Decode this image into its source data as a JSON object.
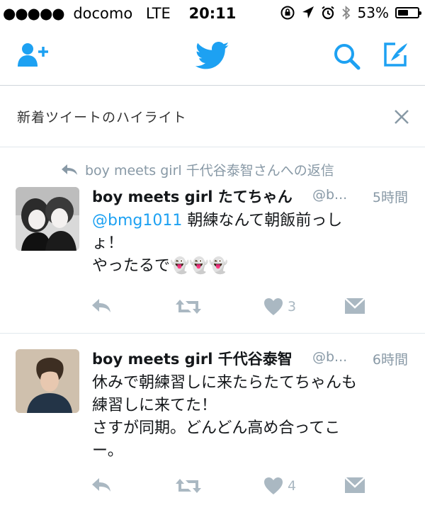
{
  "status_bar": {
    "signal": "●●●●●",
    "carrier": "docomo",
    "network": "LTE",
    "time": "20:11",
    "battery_percent": "53%",
    "battery_level": 0.53
  },
  "nav": {
    "icons": [
      "add-user-icon",
      "twitter-bird-icon",
      "search-icon",
      "compose-icon"
    ],
    "brand_color": "#1da1f2"
  },
  "banner": {
    "title": "新着ツイートのハイライト"
  },
  "tweets": [
    {
      "reply_context": "boy meets girl 千代谷泰智さんへの返信",
      "name": "boy meets girl たてちゃん",
      "handle": "@b...",
      "time": "5時間",
      "mention": "@bmg1011",
      "text_line1": " 朝練なんて朝飯前っし",
      "text_line2": "ょ！",
      "text_line3": "やったるで👻👻👻",
      "likes": "3"
    },
    {
      "name": "boy meets girl 千代谷泰智",
      "handle": "@b...",
      "time": "6時間",
      "text_line1": "休みで朝練習しに来たらたてちゃんも",
      "text_line2": "練習しに来てた！",
      "text_line3": "さすが同期。どんどん高め合ってこ",
      "text_line4": "ー。",
      "likes": "4"
    }
  ]
}
